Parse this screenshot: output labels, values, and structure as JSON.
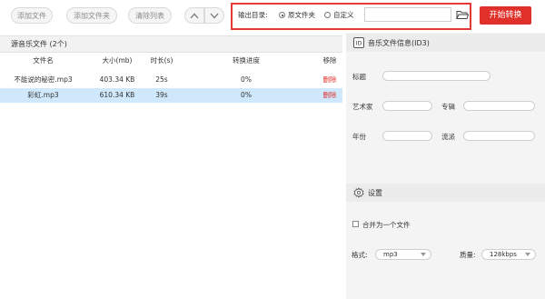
{
  "toolbar": {
    "add_file": "添加文件",
    "add_folder": "添加文件夹",
    "clear_list": "清除列表",
    "output_label": "输出目录:",
    "opt_source": "原文件夹",
    "opt_custom": "自定义",
    "path_value": "",
    "start": "开始转换"
  },
  "list": {
    "title": "源音乐文件 (2个)",
    "columns": [
      "文件名",
      "大小(mb)",
      "时长(s)",
      "转换进度",
      "移除"
    ],
    "rows": [
      {
        "name": "不能说的秘密.mp3",
        "size": "403.34 KB",
        "duration": "25s",
        "progress": "0%",
        "remove": "删除"
      },
      {
        "name": "彩虹.mp3",
        "size": "610.34 KB",
        "duration": "39s",
        "progress": "0%",
        "remove": "删除"
      }
    ]
  },
  "id3": {
    "header": "音乐文件信息(ID3)",
    "title_label": "标题",
    "artist_label": "艺术家",
    "album_label": "专辑",
    "year_label": "年份",
    "genre_label": "流派"
  },
  "settings": {
    "header": "设置",
    "merge_label": "合并为一个文件",
    "format_label": "格式:",
    "format_value": "mp3",
    "quality_label": "质量:",
    "quality_value": "128kbps"
  }
}
